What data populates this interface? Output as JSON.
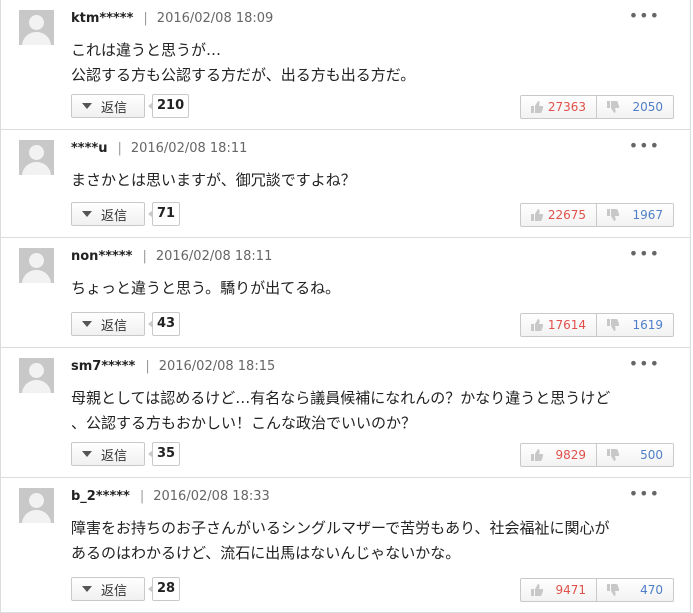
{
  "ui": {
    "reply_label": "返信",
    "more_label": "•••",
    "separator": "|",
    "thumb_up_icon": "thumb-up-icon",
    "thumb_down_icon": "thumb-down-icon",
    "colors": {
      "good": "#e0504a",
      "bad": "#4f7fc8"
    }
  },
  "comments": [
    {
      "user": "ktm*****",
      "time": "2016/02/08 18:09",
      "lines": [
        "これは違うと思うが…",
        "公認する方も公認する方だが、出る方も出る方だ。"
      ],
      "replies": "210",
      "good": "27363",
      "bad": "2050"
    },
    {
      "user": "****u",
      "time": "2016/02/08 18:11",
      "lines": [
        "まさかとは思いますが、御冗談ですよね？"
      ],
      "replies": "71",
      "good": "22675",
      "bad": "1967"
    },
    {
      "user": "non*****",
      "time": "2016/02/08 18:11",
      "lines": [
        "ちょっと違うと思う。驕りが出てるね。"
      ],
      "replies": "43",
      "good": "17614",
      "bad": "1619"
    },
    {
      "user": "sm7*****",
      "time": "2016/02/08 18:15",
      "lines": [
        "母親としては認めるけど…有名なら議員候補になれんの？かなり違うと思うけど",
        "、公認する方もおかしい！こんな政治でいいのか？"
      ],
      "replies": "35",
      "good": "9829",
      "bad": "500"
    },
    {
      "user": "b_2*****",
      "time": "2016/02/08 18:33",
      "lines": [
        "障害をお持ちのお子さんがいるシングルマザーで苦労もあり、社会福祉に関心が",
        "あるのはわかるけど、流石に出馬はないんじゃないかな。"
      ],
      "replies": "28",
      "good": "9471",
      "bad": "470"
    }
  ]
}
